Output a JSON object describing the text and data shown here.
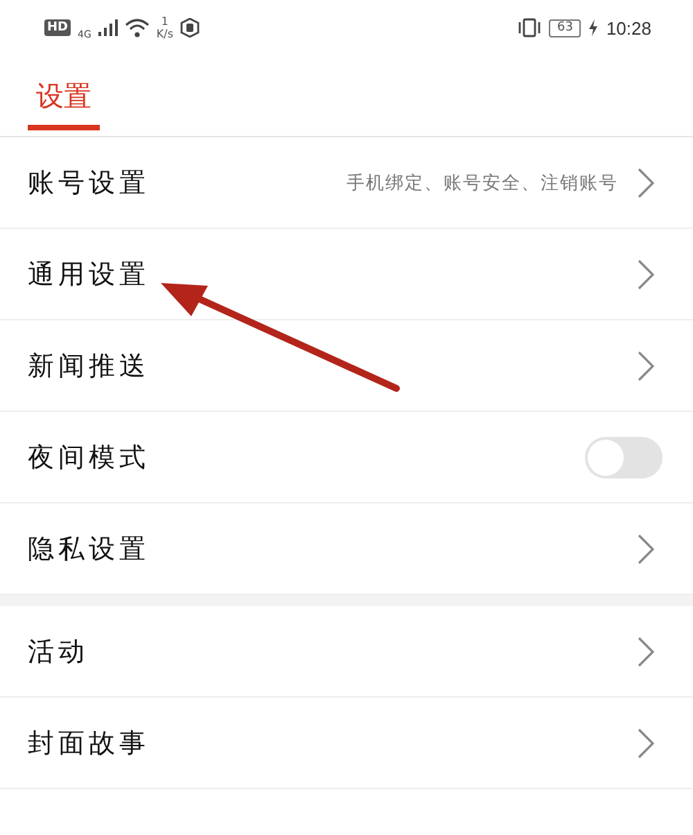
{
  "status_bar": {
    "hd": "HD",
    "network": "4G",
    "speed_value": "1",
    "speed_unit": "K/s",
    "battery": "63",
    "time": "10:28"
  },
  "tabs": [
    {
      "label": "设置",
      "selected": true
    }
  ],
  "sections": [
    {
      "rows": [
        {
          "kind": "link",
          "label": "账号设置",
          "detail": "手机绑定、账号安全、注销账号"
        },
        {
          "kind": "link",
          "label": "通用设置"
        },
        {
          "kind": "link",
          "label": "新闻推送"
        },
        {
          "kind": "toggle",
          "label": "夜间模式",
          "on": false
        },
        {
          "kind": "link",
          "label": "隐私设置"
        }
      ]
    },
    {
      "rows": [
        {
          "kind": "link",
          "label": "活动"
        },
        {
          "kind": "link",
          "label": "封面故事"
        }
      ]
    }
  ]
}
